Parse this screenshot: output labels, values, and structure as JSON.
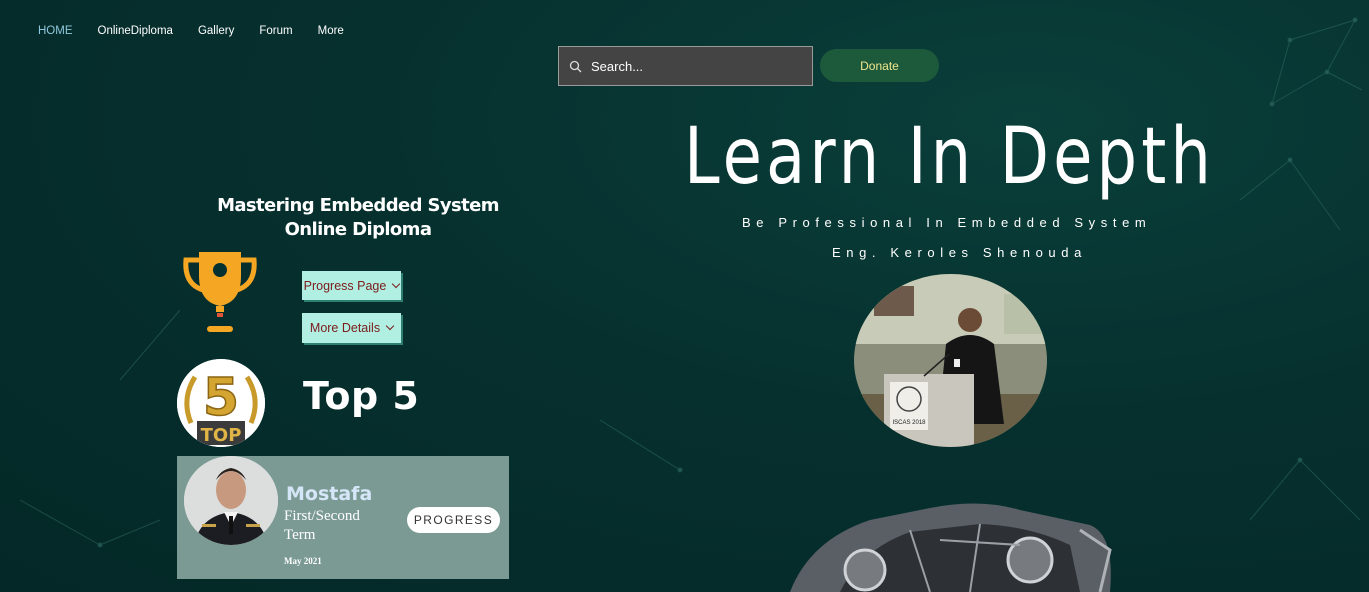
{
  "nav": {
    "items": [
      {
        "label": "HOME",
        "active": true
      },
      {
        "label": "OnlineDiploma"
      },
      {
        "label": "Gallery"
      },
      {
        "label": "Forum"
      },
      {
        "label": "More"
      }
    ]
  },
  "search": {
    "placeholder": "Search...",
    "icon": "search-icon"
  },
  "donate": {
    "label": "Donate"
  },
  "hero": {
    "title": "Learn In Depth",
    "subtitle": "Be Professional In Embedded System",
    "author": "Eng. Keroles Shenouda"
  },
  "diploma": {
    "line1": "Mastering Embedded System",
    "line2": "Online Diploma"
  },
  "buttons": {
    "progress_page": "Progress Page",
    "more_details": "More Details"
  },
  "top": {
    "label": "Top 5",
    "badge_number": "5",
    "badge_text": "TOP"
  },
  "student_card": {
    "name": "Mostafa",
    "term": "First/Second Term",
    "date": "May 2021",
    "button": "PROGRESS"
  },
  "speaker_photo": {
    "podium_text": "ISCAS 2018"
  },
  "colors": {
    "background": "#06302e",
    "accent_mint": "#b0efe2",
    "donate_bg": "#1d5a3c",
    "donate_text": "#f0e68c",
    "trophy": "#f5a623",
    "nav_active": "#8fc7dc"
  }
}
